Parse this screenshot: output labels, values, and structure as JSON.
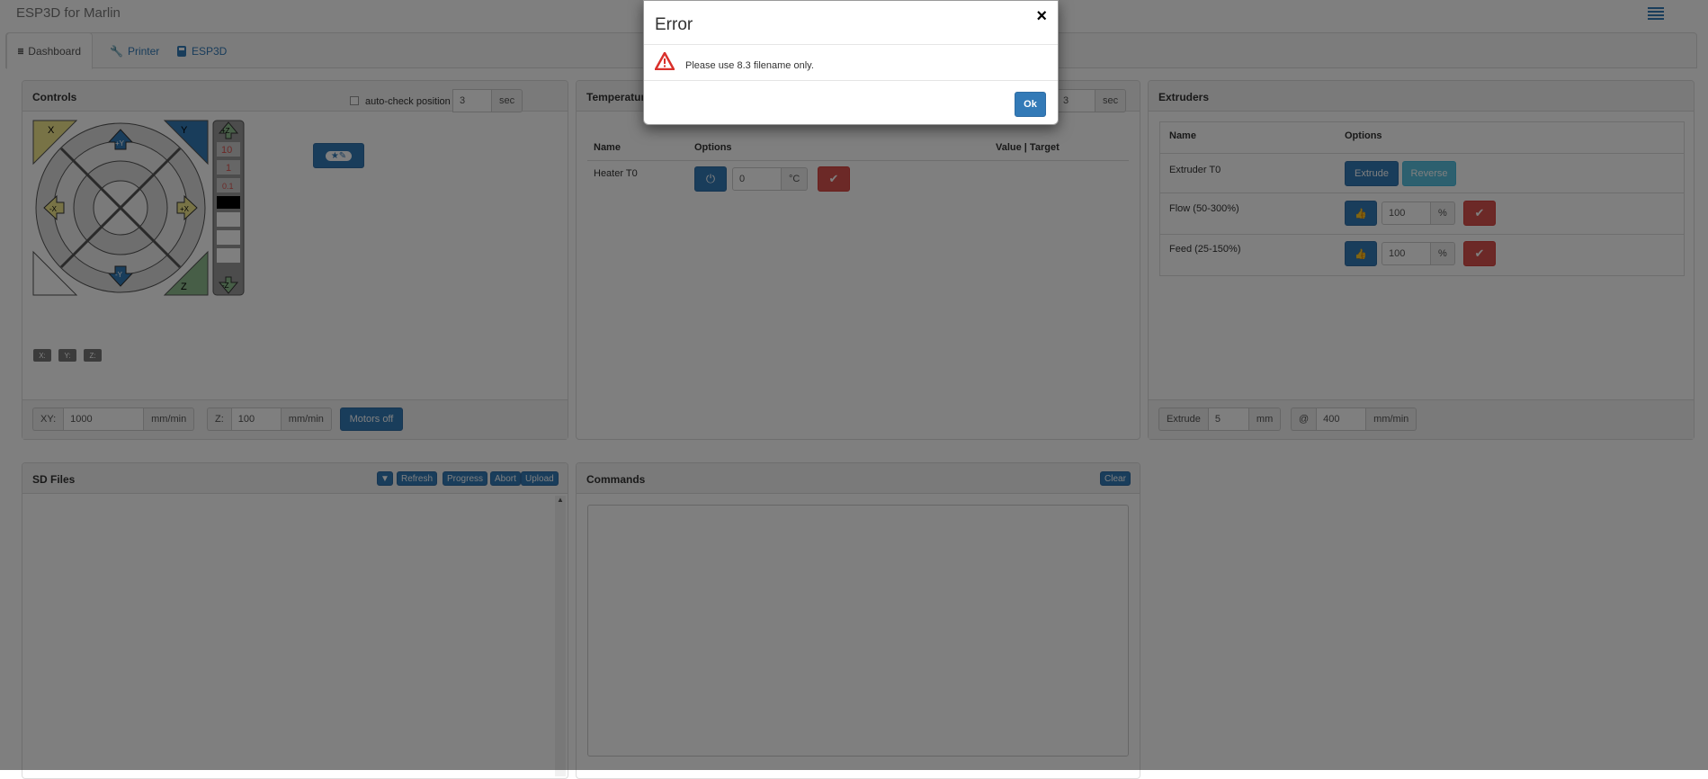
{
  "app": {
    "title": "ESP3D for Marlin"
  },
  "tabs": [
    {
      "label": "Dashboard",
      "icon": "dashboard-icon"
    },
    {
      "label": "Printer",
      "icon": "wrench-icon"
    },
    {
      "label": "ESP3D",
      "icon": "esp-icon"
    }
  ],
  "controls": {
    "title": "Controls",
    "autocheck_label": "auto-check position every:",
    "autocheck_value": "3",
    "autocheck_unit": "sec",
    "jog_labels": {
      "x": "X",
      "y": "Y",
      "z": "Z",
      "neg_x": "-X",
      "pos_x": "+X",
      "neg_y": "-Y",
      "pos_y": "+Y",
      "z_up": "+Z",
      "z_down": "-Z",
      "s10": "10",
      "s1": "1",
      "s01": "0.1"
    },
    "pos_badges": [
      "X:",
      "Y:",
      "Z:"
    ],
    "xy_label": "XY:",
    "xy_value": "1000",
    "xy_unit": "mm/min",
    "z_label": "Z:",
    "z_value": "100",
    "z_unit": "mm/min",
    "motors_off": "Motors off"
  },
  "temperatures": {
    "title": "Temperatures",
    "autocheck_value": "3",
    "autocheck_unit": "sec",
    "col_name": "Name",
    "col_options": "Options",
    "col_value": "Value | Target",
    "rows": [
      {
        "name": "Heater T0",
        "value": "0",
        "unit": "°C"
      }
    ]
  },
  "extruders": {
    "title": "Extruders",
    "col_name": "Name",
    "col_options": "Options",
    "rows": [
      {
        "name": "Extruder T0",
        "btn1": "Extrude",
        "btn2": "Reverse"
      },
      {
        "name": "Flow (50-300%)",
        "value": "100",
        "unit": "%"
      },
      {
        "name": "Feed (25-150%)",
        "value": "100",
        "unit": "%"
      }
    ],
    "extrude_label": "Extrude",
    "extrude_value": "5",
    "extrude_unit": "mm",
    "at_label": "@",
    "speed_value": "400",
    "speed_unit": "mm/min"
  },
  "sdfiles": {
    "title": "SD Files",
    "buttons": {
      "filter": "▼",
      "refresh": "Refresh",
      "progress": "Progress",
      "abort": "Abort",
      "upload": "Upload"
    }
  },
  "commands": {
    "title": "Commands",
    "clear": "Clear"
  },
  "modal": {
    "title": "Error",
    "close": "×",
    "message": "Please use 8.3 filename only.",
    "ok": "Ok"
  }
}
